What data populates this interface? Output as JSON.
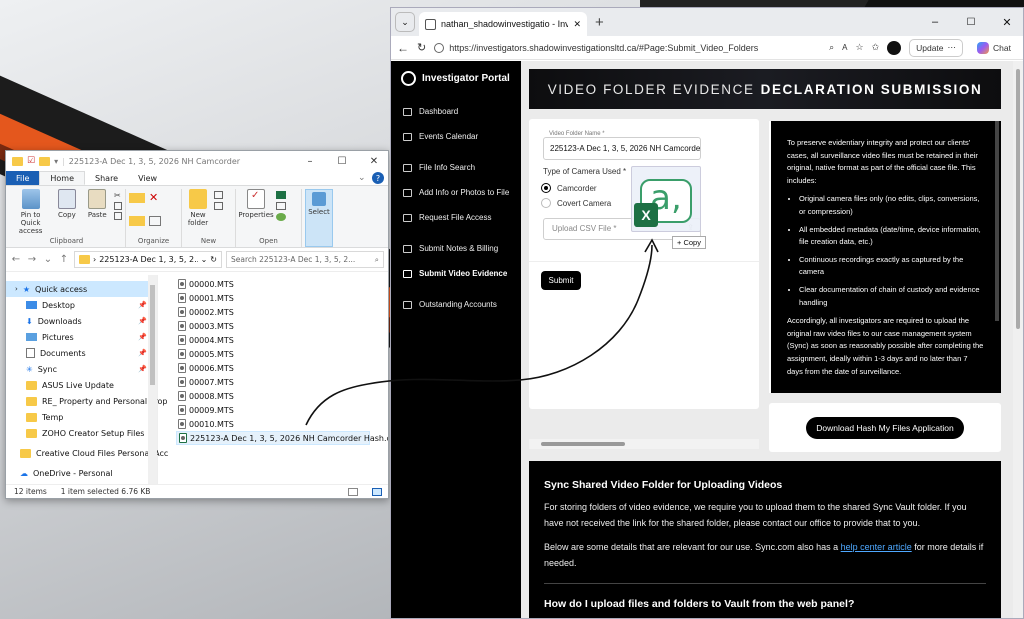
{
  "explorer": {
    "title": "225123-A Dec 1, 3, 5, 2026 NH Camcorder",
    "tabs": [
      "File",
      "Home",
      "Share",
      "View"
    ],
    "ribbon": {
      "clipboard": {
        "label": "Clipboard",
        "pin": "Pin to Quick access",
        "copy": "Copy",
        "paste": "Paste"
      },
      "organize": {
        "label": "Organize"
      },
      "new": {
        "label": "New",
        "new_folder": "New folder"
      },
      "open": {
        "label": "Open",
        "properties": "Properties"
      },
      "select": {
        "label": "Select"
      }
    },
    "address": "225123-A Dec 1, 3, 5, 2...",
    "search_placeholder": "Search 225123-A Dec 1, 3, 5, 2...",
    "nav_items": [
      "Quick access",
      "Desktop",
      "Downloads",
      "Pictures",
      "Documents",
      "Sync",
      "ASUS Live Update",
      "RE_ Property and Personal Prop",
      "Temp",
      "ZOHO Creator Setup Files",
      "Creative Cloud Files Personal Acc",
      "OneDrive - Personal"
    ],
    "files": [
      "00000.MTS",
      "00001.MTS",
      "00002.MTS",
      "00003.MTS",
      "00004.MTS",
      "00005.MTS",
      "00006.MTS",
      "00007.MTS",
      "00008.MTS",
      "00009.MTS",
      "00010.MTS",
      "225123-A Dec 1, 3, 5, 2026 NH Camcorder Hash.csv"
    ],
    "status": {
      "count": "12 items",
      "selected": "1 item selected  6.76 KB"
    }
  },
  "browser": {
    "tab_title": "nathan_shadowinvestigatio - Inve",
    "url": "https://investigators.shadowinvestigationsltd.ca/#Page:Submit_Video_Folders",
    "update_label": "Update",
    "chat_label": "Chat"
  },
  "portal": {
    "brand": "Investigator Portal",
    "nav": [
      "Dashboard",
      "Events Calendar",
      "File Info Search",
      "Add Info or Photos to File",
      "Request File Access",
      "Submit Notes & Billing",
      "Submit Video Evidence",
      "Outstanding Accounts"
    ],
    "hero_light": "VIDEO FOLDER EVIDENCE",
    "hero_bold": "DECLARATION SUBMISSION",
    "form": {
      "folder_label": "Video Folder Name *",
      "folder_value": "225123-A Dec 1, 3, 5, 2026 NH Camcorde",
      "camera_label": "Type of Camera Used *",
      "camera_options": [
        "Camcorder",
        "Covert Camera"
      ],
      "upload_placeholder": "Upload CSV File *",
      "submit": "Submit"
    },
    "info": {
      "intro": "To preserve evidentiary integrity and protect our clients' cases, all surveillance video files must be retained in their original, native format as part of the official case file. This includes:",
      "bullets": [
        "Original camera files only (no edits, clips, conversions, or compression)",
        "All embedded metadata (date/time, device information, file creation data, etc.)",
        "Continuous recordings exactly as captured by the camera",
        "Clear documentation of chain of custody and evidence handling"
      ],
      "outro": "Accordingly, all investigators are required to upload the original raw video files to our case management system (Sync) as soon as reasonably possible after completing the assignment, ideally within 1-3 days and no later than 7 days from the date of surveillance."
    },
    "download_btn": "Download Hash My Files Application",
    "sync": {
      "title": "Sync Shared Video Folder for Uploading Videos",
      "p1": "For storing folders of video evidence, we require you to upload them to the shared Sync Vault folder. If you have not received the link for the shared folder, please contact our office to provide that to you.",
      "p2a": "Below are some details that are relevant for our use. Sync.com also has a ",
      "p2link": "help center article",
      "p2b": " for more details if needed.",
      "q1": "How do I upload files and folders to Vault from the web panel?"
    }
  },
  "drag": {
    "copy_label": "+ Copy"
  }
}
